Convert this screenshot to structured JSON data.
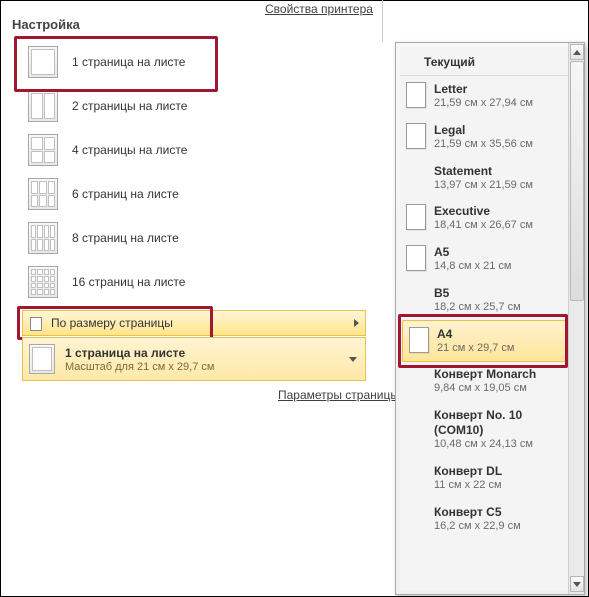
{
  "top_link": "Свойства принтера",
  "section_title": "Настройка",
  "pages_items": [
    {
      "label": "1 страница на листе"
    },
    {
      "label": "2 страницы на листе"
    },
    {
      "label": "4 страницы на листе"
    },
    {
      "label": "6 страниц на листе"
    },
    {
      "label": "8 страниц на листе"
    },
    {
      "label": "16 страниц на листе"
    }
  ],
  "submenu_label": "По размеру страницы",
  "current": {
    "title": "1 страница на листе",
    "subtitle": "Масштаб для 21 см x 29,7 см"
  },
  "page_params_link": "Параметры страницы",
  "flyout": {
    "header": "Текущий",
    "items": [
      {
        "name": "Letter",
        "dim": "21,59 см x 27,94 см",
        "icon": true
      },
      {
        "name": "Legal",
        "dim": "21,59 см x 35,56 см",
        "icon": true
      },
      {
        "name": "Statement",
        "dim": "13,97 см x 21,59 см",
        "icon": false
      },
      {
        "name": "Executive",
        "dim": "18,41 см x 26,67 см",
        "icon": true
      },
      {
        "name": "A5",
        "dim": "14,8 см x 21 см",
        "icon": true
      },
      {
        "name": "B5",
        "dim": "18,2 см x 25,7 см",
        "icon": false
      },
      {
        "name": "A4",
        "dim": "21 см x 29,7 см",
        "icon": true,
        "selected": true
      },
      {
        "name": "Конверт Monarch",
        "dim": "9,84 см x 19,05 см",
        "icon": false
      },
      {
        "name": "Конверт No. 10 (COM10)",
        "dim": "10,48 см x 24,13 см",
        "icon": false
      },
      {
        "name": "Конверт DL",
        "dim": "11 см x 22 см",
        "icon": false
      },
      {
        "name": "Конверт C5",
        "dim": "16,2 см x 22,9 см",
        "icon": false
      }
    ]
  }
}
